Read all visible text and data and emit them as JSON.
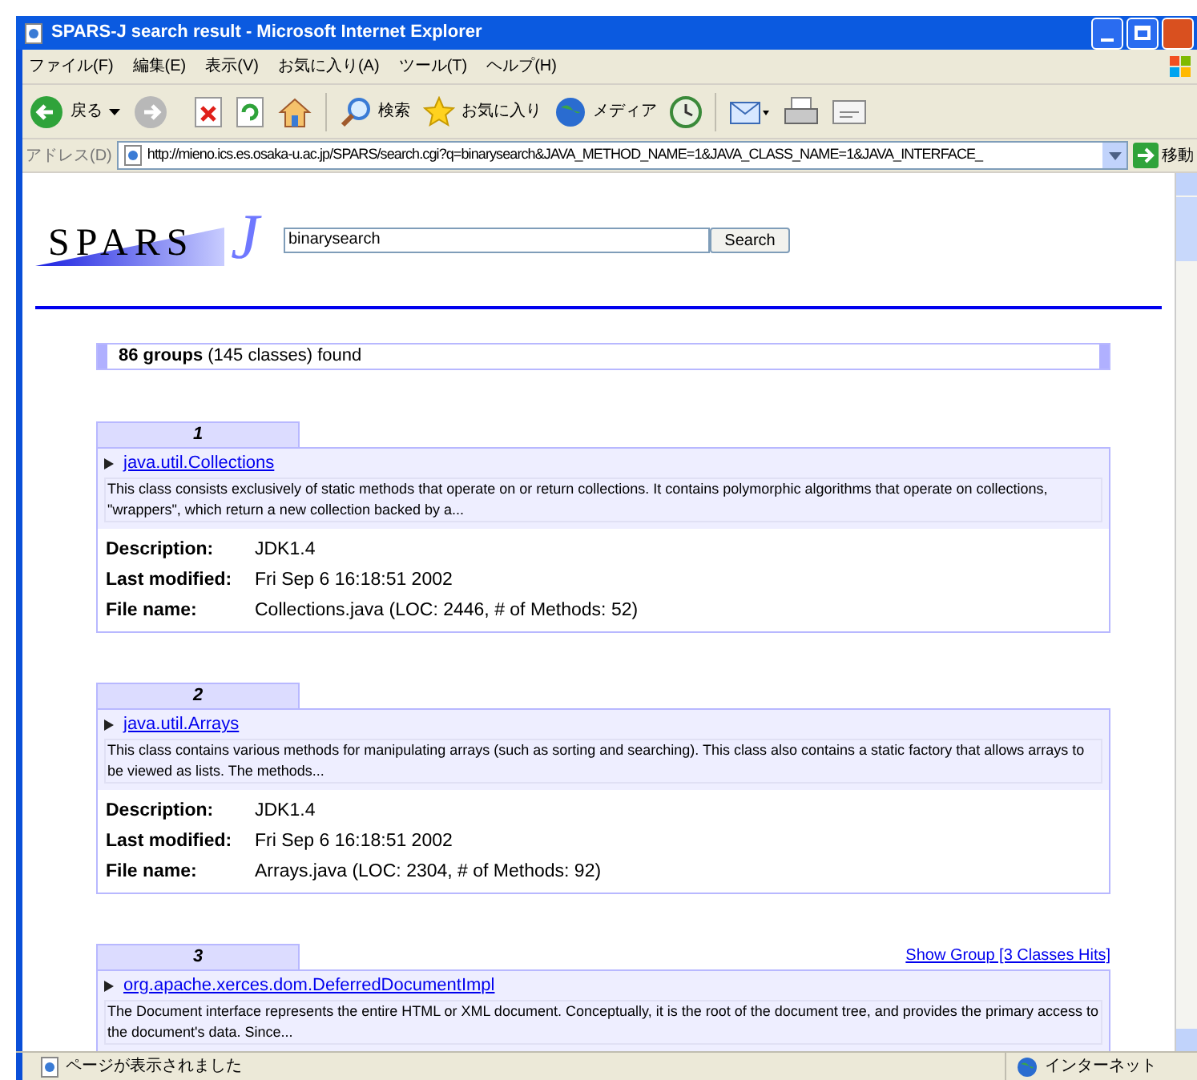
{
  "window": {
    "title": "SPARS-J search result - Microsoft Internet Explorer"
  },
  "menu": [
    "ファイル(F)",
    "編集(E)",
    "表示(V)",
    "お気に入り(A)",
    "ツール(T)",
    "ヘルプ(H)"
  ],
  "toolbar": {
    "back": "戻る",
    "search": "検索",
    "favorites": "お気に入り",
    "media": "メディア"
  },
  "address_bar": {
    "label": "アドレス(D)",
    "url": "http://mieno.ics.es.osaka-u.ac.jp/SPARS/search.cgi?q=binarysearch&JAVA_METHOD_NAME=1&JAVA_CLASS_NAME=1&JAVA_INTERFACE_",
    "go": "移動"
  },
  "logo": {
    "text": "SPARS",
    "mark": "J"
  },
  "search": {
    "value": "binarysearch",
    "button": "Search"
  },
  "summary": "**86 groups** (145 classes) found",
  "results": [
    {
      "number": "1",
      "name": "java.util.Collections",
      "snippet": "This class consists exclusively of static methods that operate on or return collections. It contains polymorphic algorithms that operate on collections, \"wrappers\", which return a new collection backed by a...",
      "fields": [
        {
          "label": "Description:",
          "value": "JDK1.4"
        },
        {
          "label": "Last modified:",
          "value": "Fri Sep 6 16:18:51 2002"
        },
        {
          "label": "File name:",
          "value": "Collections.java (LOC: 2446, # of Methods: 52)"
        }
      ]
    },
    {
      "number": "2",
      "name": "java.util.Arrays",
      "snippet": "This class contains various methods for manipulating arrays (such as sorting and searching). This class also contains a static factory that allows arrays to be viewed as lists. The methods...",
      "fields": [
        {
          "label": "Description:",
          "value": "JDK1.4"
        },
        {
          "label": "Last modified:",
          "value": "Fri Sep 6 16:18:51 2002"
        },
        {
          "label": "File name:",
          "value": "Arrays.java (LOC: 2304, # of Methods: 92)"
        }
      ]
    },
    {
      "number": "3",
      "show_group": "Show Group [3 Classes Hits]",
      "name": "org.apache.xerces.dom.DeferredDocumentImpl",
      "snippet": "The Document interface represents the entire HTML or XML document. Conceptually, it is the root of the document tree, and provides the primary access to the document's data. Since..."
    }
  ],
  "status_bar": {
    "text": "ページが表示されました",
    "zone": "インターネット"
  }
}
